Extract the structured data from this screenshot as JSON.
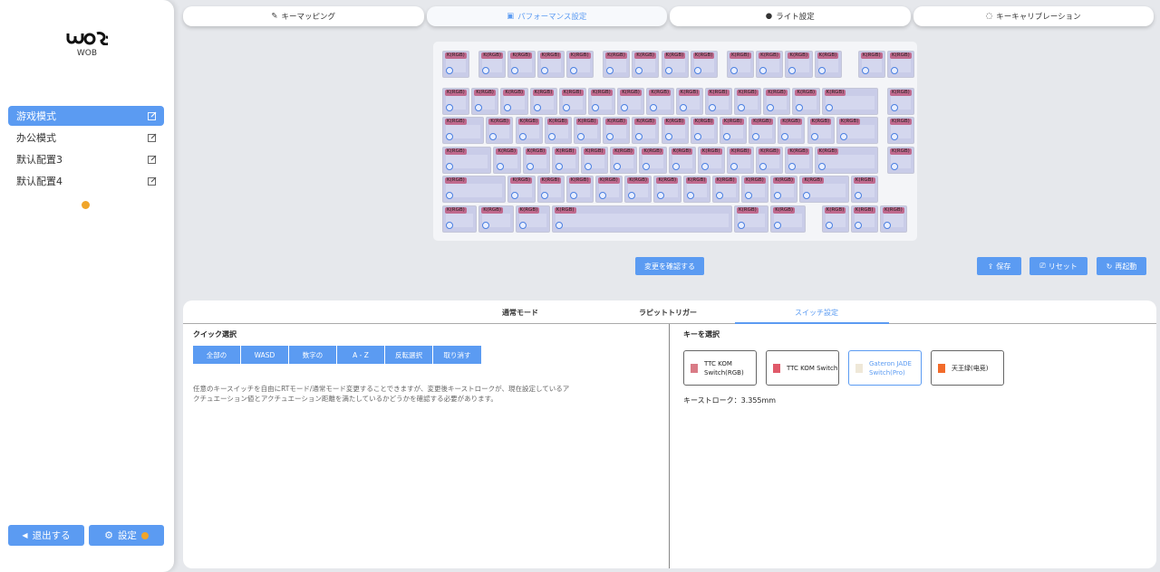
{
  "app": {
    "logo_text": "WOB"
  },
  "sidebar": {
    "profiles": [
      {
        "label": "游戏模式",
        "active": true
      },
      {
        "label": "办公模式",
        "active": false
      },
      {
        "label": "默认配置3",
        "active": false
      },
      {
        "label": "默认配置4",
        "active": false
      }
    ],
    "logout_label": "退出する",
    "settings_label": "設定"
  },
  "tabs": [
    {
      "label": "キーマッピング",
      "icon": "pen-icon",
      "active": false
    },
    {
      "label": "パフォーマンス設定",
      "icon": "speed-icon",
      "active": true
    },
    {
      "label": "ライト設定",
      "icon": "bulb-icon",
      "active": false
    },
    {
      "label": "キーキャリブレーション",
      "icon": "calibrate-icon",
      "active": false
    }
  ],
  "keyboard": {
    "key_label": "K(RGB)",
    "key_count": 84
  },
  "actions": {
    "confirm_label": "変更を確認する",
    "save_label": "保存",
    "reset_label": "リセット",
    "reboot_label": "再起動"
  },
  "panel": {
    "sub_tabs": [
      {
        "label": "通常モード",
        "active": false
      },
      {
        "label": "ラピットトリガー",
        "active": false
      },
      {
        "label": "スイッチ設定",
        "active": true
      }
    ],
    "quick_title": "クイック選択",
    "quick_buttons": [
      "全部の",
      "WASD",
      "数字の",
      "A - Z",
      "反転選択",
      "取り消す"
    ],
    "note": "任意のキースイッチを自由にRTモード/通常モード変更することできますが、変更後キーストロークが、現在設定しているアクチュエーション値とアクチュエーション距離を満たしているかどうかを確認する必要があります。",
    "select_title": "キーを選択",
    "switches": [
      {
        "label": "TTC KOM Switch(RGB)",
        "color": "#d97b86",
        "active": false
      },
      {
        "label": "TTC KOM Switch",
        "color": "#e05a6a",
        "active": false
      },
      {
        "label": "Gateron JADE Switch(Pro)",
        "color": "#efe8d8",
        "active": true
      },
      {
        "label": "天王绿(电竞)",
        "color": "#f26b2a",
        "active": false
      }
    ],
    "stroke_text": "キーストローク：3.355mm"
  },
  "colors": {
    "accent": "#5b9bf2",
    "key": "#c9cce8",
    "key_label": "#c06a8e",
    "warning": "#f0a52a"
  }
}
